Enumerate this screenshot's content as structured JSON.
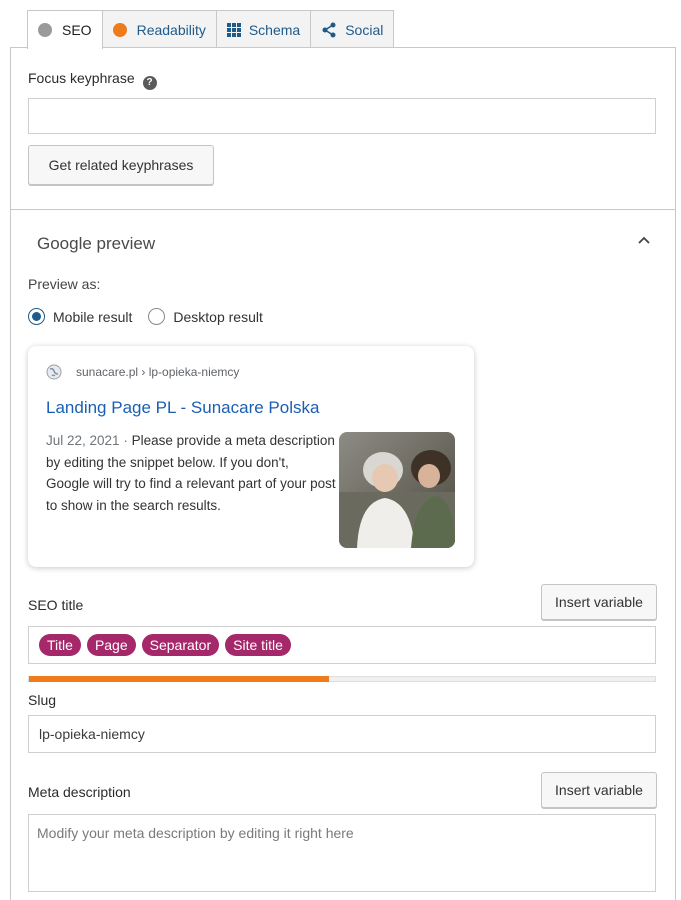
{
  "tabs": [
    {
      "label": "SEO",
      "icon": "gray-dot-icon",
      "color": "#9a9a9a",
      "active": true
    },
    {
      "label": "Readability",
      "icon": "orange-dot-icon",
      "color": "#ee7c1b",
      "active": false
    },
    {
      "label": "Schema",
      "icon": "schema-grid-icon",
      "active": false
    },
    {
      "label": "Social",
      "icon": "share-icon",
      "active": false
    }
  ],
  "focus": {
    "label": "Focus keyphrase",
    "value": "",
    "button": "Get related keyphrases"
  },
  "google_preview": {
    "title": "Google preview",
    "preview_as": "Preview as:",
    "options": [
      "Mobile result",
      "Desktop result"
    ],
    "selected": "Mobile result",
    "card": {
      "url": "sunacare.pl › lp-opieka-niemcy",
      "title": "Landing Page PL - Sunacare Polska",
      "date": "Jul 22, 2021",
      "separator": " · ",
      "description": "Please provide a meta description by editing the snippet below. If you don't, Google will try to find a relevant part of your post to show in the search results."
    }
  },
  "seo_title": {
    "label": "SEO title",
    "insert_button": "Insert variable",
    "pills": [
      "Title",
      "Page",
      "Separator",
      "Site title"
    ],
    "progress_percent": 48
  },
  "slug": {
    "label": "Slug",
    "value": "lp-opieka-niemcy"
  },
  "meta": {
    "label": "Meta description",
    "insert_button": "Insert variable",
    "placeholder": "Modify your meta description by editing it right here"
  },
  "colors": {
    "accent": "#1e5a8a",
    "pill": "#a4286a",
    "progress": "#ee7c1b",
    "link": "#1a5fb4"
  }
}
